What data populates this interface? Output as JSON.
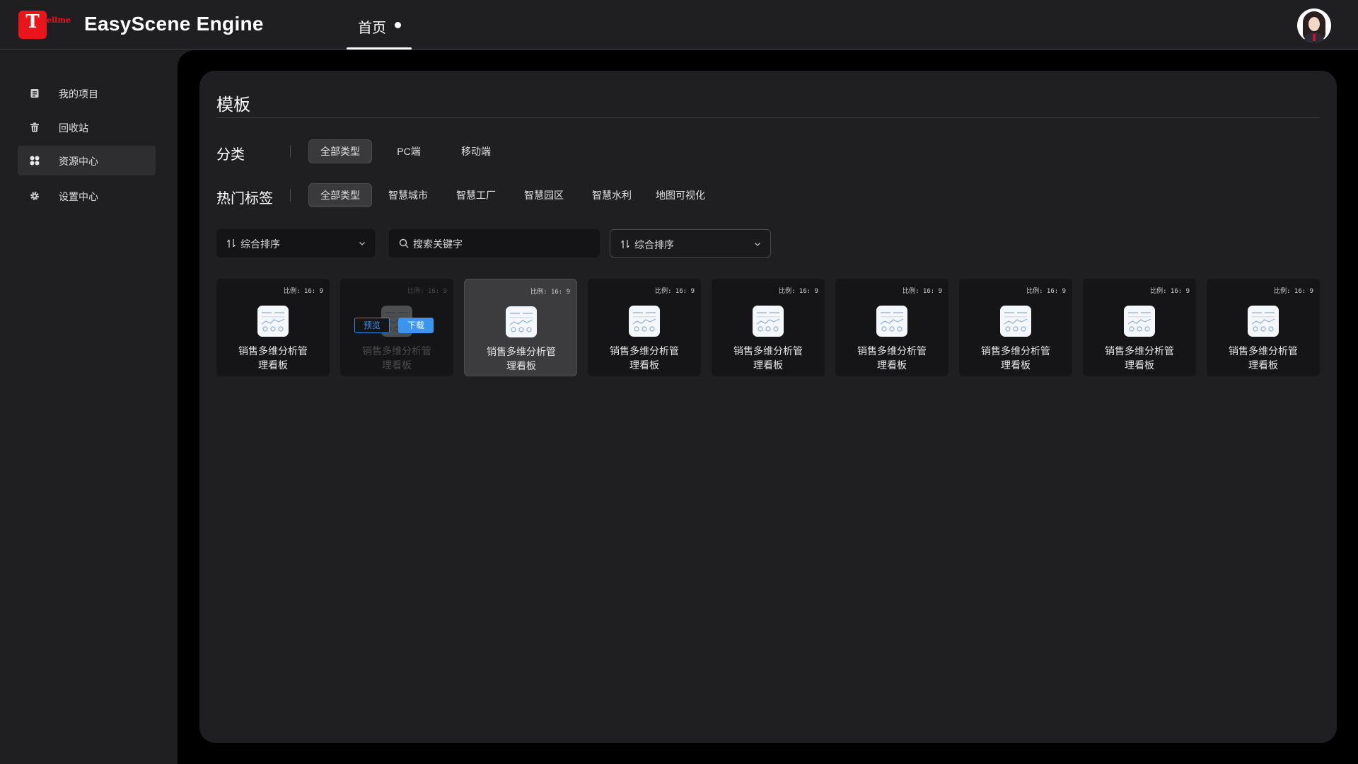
{
  "app": {
    "logo_letter": "T",
    "logo_text": "ellme",
    "title": "EasyScene Engine"
  },
  "header": {
    "home_tab": "首页"
  },
  "sidebar": {
    "items": [
      {
        "label": "我的项目",
        "icon": "project-icon"
      },
      {
        "label": "回收站",
        "icon": "trash-icon"
      },
      {
        "label": "资源中心",
        "icon": "grid-icon",
        "active": true
      },
      {
        "label": "设置中心",
        "icon": "gear-icon"
      }
    ]
  },
  "main": {
    "title": "模板",
    "category": {
      "label": "分类",
      "chips": [
        "全部类型",
        "PC端",
        "移动端"
      ]
    },
    "tags": {
      "label": "热门标签",
      "chips": [
        "全部类型",
        "智慧城市",
        "智慧工厂",
        "智慧园区",
        "智慧水利",
        "地图可视化"
      ]
    },
    "filters": {
      "sort1": "综合排序",
      "search_placeholder": "搜索关键字",
      "sort2": "综合排序"
    },
    "cards": [
      {
        "ratio": "比例: 16: 9",
        "name": "销售多维分析管理看板"
      },
      {
        "ratio": "比例: 16: 9",
        "name": "销售多维分析管理看板"
      },
      {
        "ratio": "比例: 16: 9",
        "name": "销售多维分析管理看板"
      },
      {
        "ratio": "比例: 16: 9",
        "name": "销售多维分析管理看板"
      },
      {
        "ratio": "比例: 16: 9",
        "name": "销售多维分析管理看板"
      },
      {
        "ratio": "比例: 16: 9",
        "name": "销售多维分析管理看板"
      },
      {
        "ratio": "比例: 16: 9",
        "name": "销售多维分析管理看板"
      },
      {
        "ratio": "比例: 16: 9",
        "name": "销售多维分析管理看板"
      },
      {
        "ratio": "比例: 16: 9",
        "name": "销售多维分析管理看板"
      }
    ],
    "card_actions": {
      "preview": "预览",
      "download": "下载"
    }
  },
  "colors": {
    "brand": "#e8151b",
    "accent": "#3a95f0",
    "background": "#1f1f21"
  }
}
